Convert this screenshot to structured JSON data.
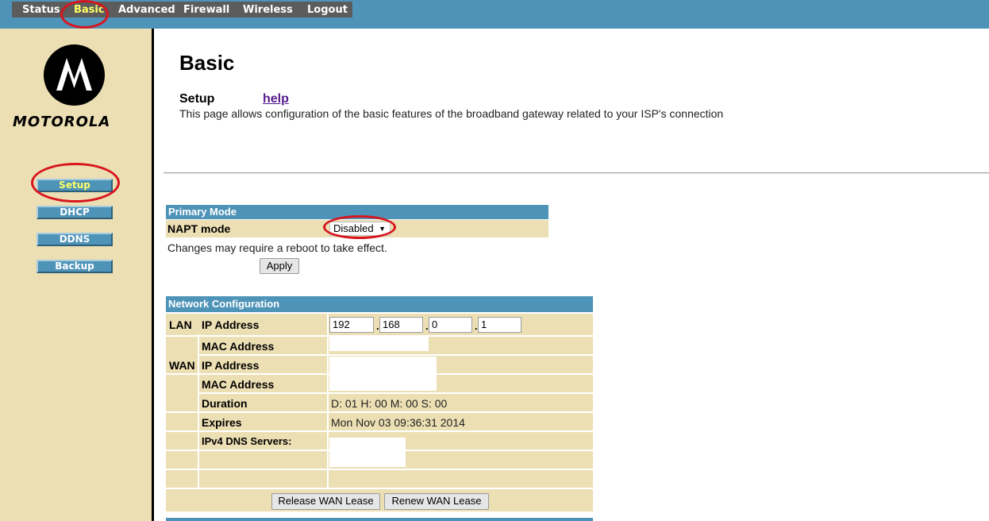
{
  "nav": {
    "items": [
      {
        "label": "Status"
      },
      {
        "label": "Basic"
      },
      {
        "label": "Advanced"
      },
      {
        "label": "Firewall"
      },
      {
        "label": "Wireless"
      },
      {
        "label": "Logout"
      }
    ],
    "active": "Basic"
  },
  "brand": {
    "name": "MOTOROLA"
  },
  "sidebar": {
    "items": [
      {
        "label": "Setup"
      },
      {
        "label": "DHCP"
      },
      {
        "label": "DDNS"
      },
      {
        "label": "Backup"
      }
    ],
    "active": "Setup"
  },
  "page": {
    "title": "Basic",
    "subtitle": "Setup",
    "help": "help",
    "description": "This page allows configuration of the basic features of the broadband gateway related to your ISP's connection"
  },
  "primary_mode": {
    "header": "Primary Mode",
    "napt_label": "NAPT mode",
    "napt_value": "Disabled",
    "note": "Changes may require a reboot to take effect.",
    "apply": "Apply"
  },
  "network": {
    "header": "Network Configuration",
    "lan_label": "LAN",
    "wan_label": "WAN",
    "ip_label": "IP Address",
    "mac_label": "MAC Address",
    "wan_ip_label": "IP Address",
    "wan_mac_label": "MAC Address",
    "lan_ip": [
      "192",
      "168",
      "0",
      "1"
    ],
    "duration_label": "Duration",
    "duration_value": "D: 01 H: 00 M: 00 S: 00",
    "expires_label": "Expires",
    "expires_value": "Mon Nov 03 09:36:31 2014",
    "dns_label": "IPv4 DNS Servers:",
    "release_button": "Release WAN Lease",
    "renew_button": "Renew WAN Lease"
  },
  "colors": {
    "header_blue": "#4e93b8",
    "panel_tan": "#ecdfb3",
    "highlight_red": "#d8151e",
    "active_yellow": "#ffff66"
  }
}
